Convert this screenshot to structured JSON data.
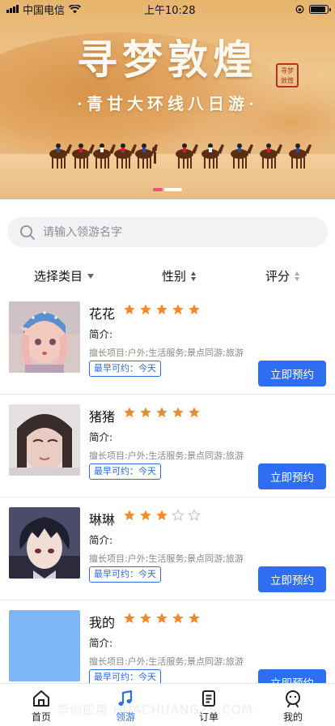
{
  "status_bar": {
    "carrier": "中国电信",
    "time": "上午10:28"
  },
  "banner": {
    "title": "寻梦敦煌",
    "subtitle": "·青甘大环线八日游·",
    "seal_text": [
      "寻梦",
      "敦煌"
    ],
    "slide_count": 2,
    "active_slide": 1
  },
  "search": {
    "placeholder": "请输入领游名字",
    "value": ""
  },
  "filters": {
    "category": "选择类目",
    "gender": "性别",
    "rating": "评分"
  },
  "guides": [
    {
      "name": "花花",
      "rating": 5,
      "intro": "简介:",
      "skills": "擅长项目:户外;生活服务;景点同游;旅游",
      "available": "最早可约：今天",
      "book_label": "立即预约",
      "avatar": "anime-girl-headscarf"
    },
    {
      "name": "猪猪",
      "rating": 5,
      "intro": "简介:",
      "skills": "擅长项目:户外;生活服务;景点同游;旅游",
      "available": "最早可约：今天",
      "book_label": "立即预约",
      "avatar": "girl-selfie"
    },
    {
      "name": "琳琳",
      "rating": 3,
      "intro": "简介:",
      "skills": "擅长项目:户外;生活服务;景点同游;旅游",
      "available": "最早可约：今天",
      "book_label": "立即预约",
      "avatar": "anime-boy-dark-hair"
    },
    {
      "name": "我的",
      "rating": 5,
      "intro": "简介:",
      "skills": "擅长项目:户外;生活服务;景点同游;旅游",
      "available": "最早可约：今天",
      "book_label": "立即预约",
      "avatar": "blue-placeholder"
    }
  ],
  "tabbar": [
    {
      "label": "首页",
      "icon": "home-icon",
      "active": false
    },
    {
      "label": "领游",
      "icon": "music-note-icon",
      "active": true
    },
    {
      "label": "订单",
      "icon": "order-icon",
      "active": false
    },
    {
      "label": "我的",
      "icon": "profile-icon",
      "active": false
    }
  ],
  "watermark": "华创应用 HUACHUANGZS.COM",
  "colors": {
    "primary": "#2f6ef2",
    "star": "#f08a2c",
    "star_empty": "#c7c7c7",
    "indicator": "#e8527b"
  }
}
